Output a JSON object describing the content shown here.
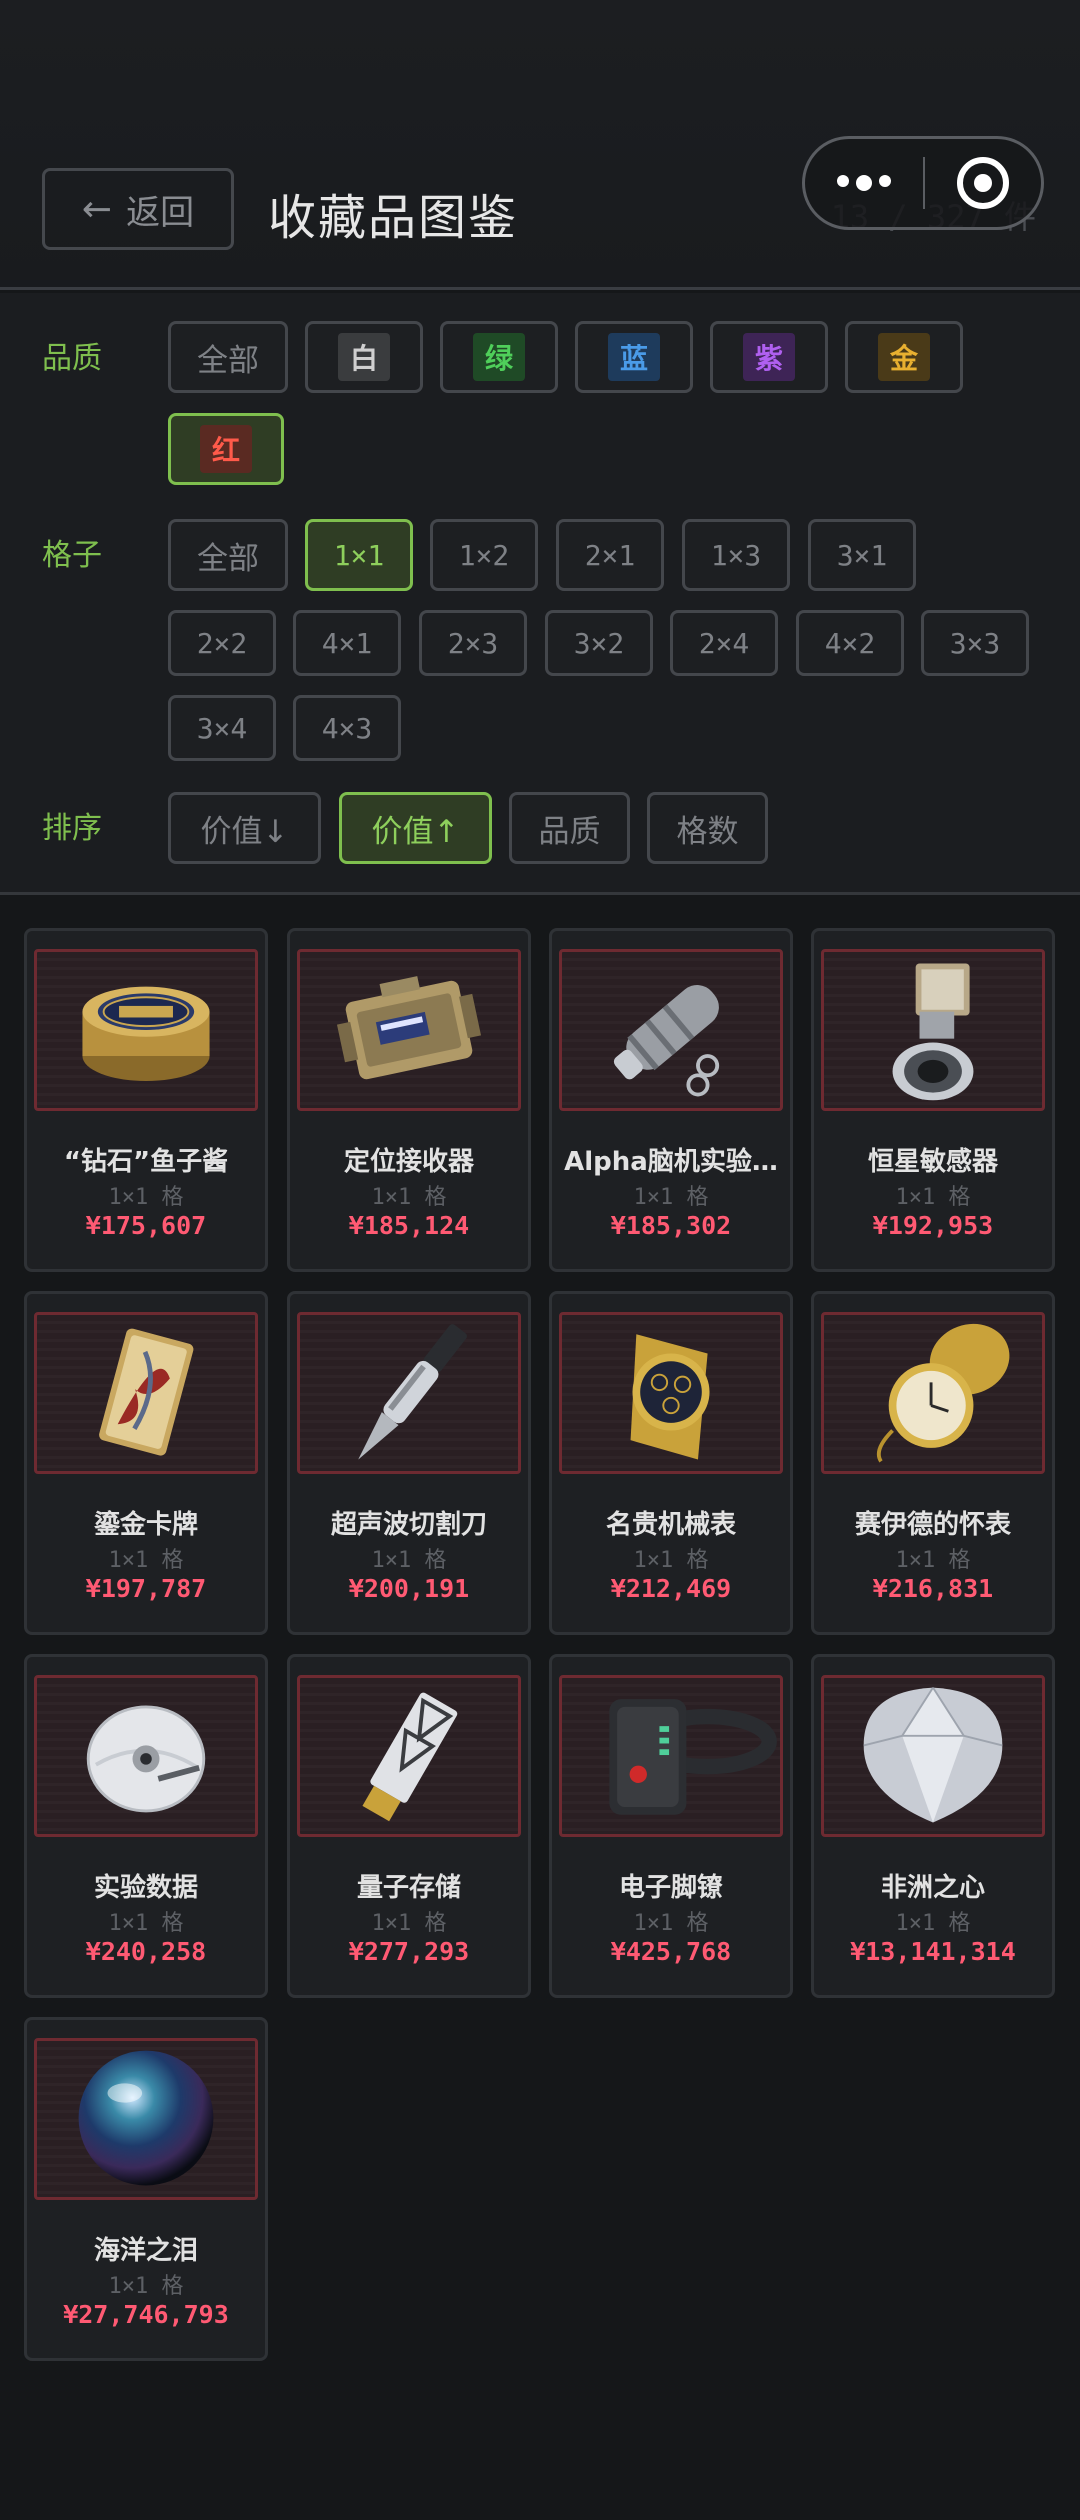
{
  "header": {
    "back_label": "返回",
    "title": "收藏品图鉴",
    "count": "13 / 327 件"
  },
  "filters": {
    "quality_label": "品质",
    "quality_options": [
      {
        "label": "全部",
        "color": null
      },
      {
        "label": "白",
        "color": "#d0d0d0"
      },
      {
        "label": "绿",
        "color": "#4fcf5a"
      },
      {
        "label": "蓝",
        "color": "#4a9be8"
      },
      {
        "label": "紫",
        "color": "#b060f0"
      },
      {
        "label": "金",
        "color": "#e8b030"
      },
      {
        "label": "红",
        "color": "#ff5a4a",
        "selected": true
      }
    ],
    "grid_label": "格子",
    "grid_options": [
      "全部",
      "1×1",
      "1×2",
      "2×1",
      "1×3",
      "3×1",
      "2×2",
      "4×1",
      "2×3",
      "3×2",
      "2×4",
      "4×2",
      "3×3",
      "3×4",
      "4×3"
    ],
    "grid_selected": "1×1",
    "sort_label": "排序",
    "sort_options": [
      "价值↓",
      "价值↑",
      "品质",
      "格数"
    ],
    "sort_selected": "价值↑"
  },
  "items": [
    {
      "name": "“钻石”鱼子酱",
      "size": "1×1 格",
      "price": "¥175,607",
      "icon": "caviar-tin-icon"
    },
    {
      "name": "定位接收器",
      "size": "1×1 格",
      "price": "¥185,124",
      "icon": "locator-receiver-icon"
    },
    {
      "name": "Alpha脑机实验…",
      "size": "1×1 格",
      "price": "¥185,302",
      "icon": "brain-machine-device-icon"
    },
    {
      "name": "恒星敏感器",
      "size": "1×1 格",
      "price": "¥192,953",
      "icon": "star-sensor-icon"
    },
    {
      "name": "鎏金卡牌",
      "size": "1×1 格",
      "price": "¥197,787",
      "icon": "gilded-card-icon"
    },
    {
      "name": "超声波切割刀",
      "size": "1×1 格",
      "price": "¥200,191",
      "icon": "ultrasonic-knife-icon"
    },
    {
      "name": "名贵机械表",
      "size": "1×1 格",
      "price": "¥212,469",
      "icon": "luxury-watch-icon"
    },
    {
      "name": "赛伊德的怀表",
      "size": "1×1 格",
      "price": "¥216,831",
      "icon": "pocket-watch-icon"
    },
    {
      "name": "实验数据",
      "size": "1×1 格",
      "price": "¥240,258",
      "icon": "data-disc-icon"
    },
    {
      "name": "量子存储",
      "size": "1×1 格",
      "price": "¥277,293",
      "icon": "quantum-storage-icon"
    },
    {
      "name": "电子脚镣",
      "size": "1×1 格",
      "price": "¥425,768",
      "icon": "electronic-anklet-icon"
    },
    {
      "name": "非洲之心",
      "size": "1×1 格",
      "price": "¥13,141,314",
      "icon": "diamond-icon"
    },
    {
      "name": "海洋之泪",
      "size": "1×1 格",
      "price": "¥27,746,793",
      "icon": "ocean-pearl-icon"
    }
  ],
  "colors": {
    "accent_green": "#7fbf4e",
    "price_red": "#ff5a73",
    "item_frame_red": "#6e2a31"
  }
}
